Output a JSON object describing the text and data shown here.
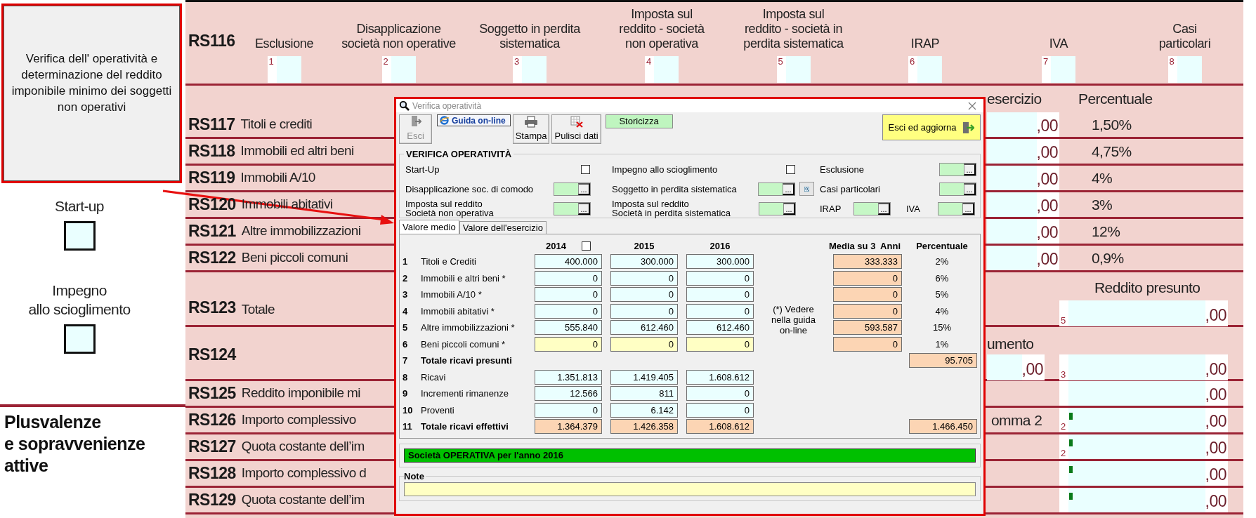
{
  "callout": {
    "text": "Verifica dell' operatività e determinazione del reddito imponibile minimo dei soggetti non operativi"
  },
  "side_options": [
    {
      "label": [
        "Start-up"
      ],
      "checked": false
    },
    {
      "label": [
        "Impegno",
        "allo scioglimento"
      ],
      "checked": false
    }
  ],
  "section_title": [
    "Plusvalenze",
    "e sopravvenienze",
    "attive"
  ],
  "form": {
    "header_row": {
      "code": "RS116",
      "fields": [
        {
          "label": [
            "Esclusione"
          ],
          "number": "1"
        },
        {
          "label": [
            "Disapplicazione",
            "società non operative"
          ],
          "number": "2"
        },
        {
          "label": [
            "Soggetto in perdita",
            "sistematica"
          ],
          "number": "3"
        },
        {
          "label": [
            "Imposta sul",
            "reddito - società",
            "non operativa"
          ],
          "number": "4"
        },
        {
          "label": [
            "Imposta sul",
            "reddito - società in",
            "perdita sistematica"
          ],
          "number": "5"
        },
        {
          "label": [
            "IRAP"
          ],
          "number": "6"
        },
        {
          "label": [
            "IVA"
          ],
          "number": "7"
        },
        {
          "label": [
            "Casi",
            "particolari"
          ],
          "number": "8"
        }
      ]
    },
    "column_headers": [
      "esercizio",
      "Percentuale"
    ],
    "rows": [
      {
        "code": "RS117",
        "label": "Titoli e crediti",
        "kind": "rate",
        "value": ",00",
        "rate": "1,50%"
      },
      {
        "code": "RS118",
        "label": "Immobili ed altri beni",
        "kind": "rate",
        "value": ",00",
        "rate": "4,75%"
      },
      {
        "code": "RS119",
        "label": "Immobili A/10",
        "kind": "rate",
        "value": ",00",
        "rate": "4%"
      },
      {
        "code": "RS120",
        "label": "Immobili abitativi",
        "kind": "rate",
        "value": ",00",
        "rate": "3%"
      },
      {
        "code": "RS121",
        "label": "Altre immobilizzazioni",
        "kind": "rate",
        "value": ",00",
        "rate": "12%"
      },
      {
        "code": "RS122",
        "label": "Beni piccoli comuni",
        "kind": "rate",
        "value": ",00",
        "rate": "0,9%"
      },
      {
        "code": "RS123",
        "label": "Totale",
        "kind": "total",
        "header": "Reddito presunto",
        "number": "5",
        "value": ",00"
      },
      {
        "code": "RS124",
        "kind": "split",
        "side_header": "umento",
        "side_value": ",00",
        "number": "3",
        "value": ",00"
      },
      {
        "code": "RS125",
        "label": "Reddito imponibile mi",
        "kind": "plain",
        "marked": false,
        "value": ",00"
      },
      {
        "code": "RS126",
        "label": "Importo complessivo",
        "kind": "plain",
        "note": "omma 2",
        "number": "2",
        "marked": true,
        "value": ",00"
      },
      {
        "code": "RS127",
        "label": "Quota costante dell’im",
        "kind": "plain",
        "number": "2",
        "marked": true,
        "value": ",00"
      },
      {
        "code": "RS128",
        "label": "Importo complessivo d",
        "kind": "plain",
        "marked": true,
        "value": ",00"
      },
      {
        "code": "RS129",
        "label": "Quota costante dell’im",
        "kind": "plain",
        "marked": true,
        "value": ",00"
      }
    ]
  },
  "dialog": {
    "title": "Verifica operatività",
    "toolbar": [
      {
        "label": "Esci",
        "kind": "exit",
        "disabled": true
      },
      {
        "label": "Guida on-line",
        "kind": "help",
        "disabled": false
      },
      {
        "label": "Stampa",
        "kind": "print",
        "disabled": false
      },
      {
        "label": "Pulisci dati",
        "kind": "clear",
        "disabled": false
      },
      {
        "label": "Storicizza",
        "kind": "action",
        "disabled": false
      },
      {
        "label": "Esci ed aggiorna",
        "kind": "confirm",
        "disabled": false
      }
    ],
    "group": {
      "title": "VERIFICA OPERATIVITÀ",
      "rows": [
        [
          [
            {
              "label": [
                "Start-Up"
              ],
              "kind": "checkbox",
              "checked": false
            }
          ],
          [
            {
              "label": [
                "Impegno allo scioglimento"
              ],
              "kind": "checkbox",
              "checked": false
            }
          ],
          [
            {
              "label": [
                "Esclusione"
              ],
              "kind": "picker",
              "button": "..."
            }
          ]
        ],
        [
          [
            {
              "label": [
                "Disapplicazione soc. di comodo"
              ],
              "kind": "picker",
              "button": "..."
            }
          ],
          [
            {
              "label": [
                "Soggetto in perdita sistematica"
              ],
              "kind": "picker_search",
              "button": "..."
            }
          ],
          [
            {
              "label": [
                "Casi particolari"
              ],
              "kind": "picker",
              "button": "..."
            }
          ]
        ],
        [
          [
            {
              "label": [
                "Imposta sul reddito",
                "Società non operativa"
              ],
              "kind": "picker",
              "button": "..."
            }
          ],
          [
            {
              "label": [
                "Imposta sul reddito",
                "Società in perdita sistematica"
              ],
              "kind": "picker",
              "button": "..."
            }
          ],
          [
            {
              "label": [
                "IRAP"
              ],
              "kind": "picker",
              "button": "..."
            },
            {
              "label": [
                "IVA"
              ],
              "kind": "picker",
              "button": "..."
            }
          ]
        ]
      ]
    },
    "tabs": [
      {
        "label": "Valore medio",
        "selected": true
      },
      {
        "label": "Valore dell'esercizio",
        "selected": false
      }
    ],
    "table": {
      "columns": [
        {
          "label": "2014",
          "checked": false
        },
        {
          "label": "2015"
        },
        {
          "label": "2016"
        },
        {
          "label": "Media su 3  Anni"
        },
        {
          "label": "Percentuale"
        }
      ],
      "note": [
        "(*) Vedere",
        "nella guida",
        "on-line"
      ],
      "rows": [
        {
          "number": "1",
          "label": "Titoli e Crediti",
          "kind": "entry",
          "values": [
            "400.000",
            "300.000",
            "300.000"
          ],
          "average": "333.333",
          "percent": "2%"
        },
        {
          "number": "2",
          "label": "Immobili e altri beni *",
          "kind": "entry",
          "values": [
            "0",
            "0",
            "0"
          ],
          "average": "0",
          "percent": "6%"
        },
        {
          "number": "3",
          "label": "Immobili A/10 *",
          "kind": "entry",
          "values": [
            "0",
            "0",
            "0"
          ],
          "average": "0",
          "percent": "5%"
        },
        {
          "number": "4",
          "label": "Immobili abitativi *",
          "kind": "entry",
          "values": [
            "0",
            "0",
            "0"
          ],
          "average": "0",
          "percent": "4%"
        },
        {
          "number": "5",
          "label": "Altre immobilizzazioni *",
          "kind": "entry",
          "values": [
            "555.840",
            "612.460",
            "612.460"
          ],
          "average": "593.587",
          "percent": "15%"
        },
        {
          "number": "6",
          "label": "Beni piccoli comuni *",
          "kind": "highlight",
          "values": [
            "0",
            "0",
            "0"
          ],
          "average": "0",
          "percent": "1%"
        },
        {
          "number": "7",
          "label": "Totale ricavi presunti",
          "kind": "total",
          "total": "95.705"
        },
        {
          "number": "8",
          "label": "Ricavi",
          "kind": "entry",
          "values": [
            "1.351.813",
            "1.419.405",
            "1.608.612"
          ]
        },
        {
          "number": "9",
          "label": "Incrementi rimanenze",
          "kind": "entry",
          "values": [
            "12.566",
            "811",
            "0"
          ]
        },
        {
          "number": "10",
          "label": "Proventi",
          "kind": "entry",
          "values": [
            "0",
            "6.142",
            "0"
          ]
        },
        {
          "number": "11",
          "label": "Totale ricavi effettivi",
          "kind": "total",
          "values": [
            "1.364.379",
            "1.426.358",
            "1.608.612"
          ],
          "total": "1.466.450"
        }
      ]
    },
    "status": {
      "text": "Società OPERATIVA per l'anno 2016",
      "operative": true
    },
    "note_box": {
      "title": "Note"
    }
  }
}
